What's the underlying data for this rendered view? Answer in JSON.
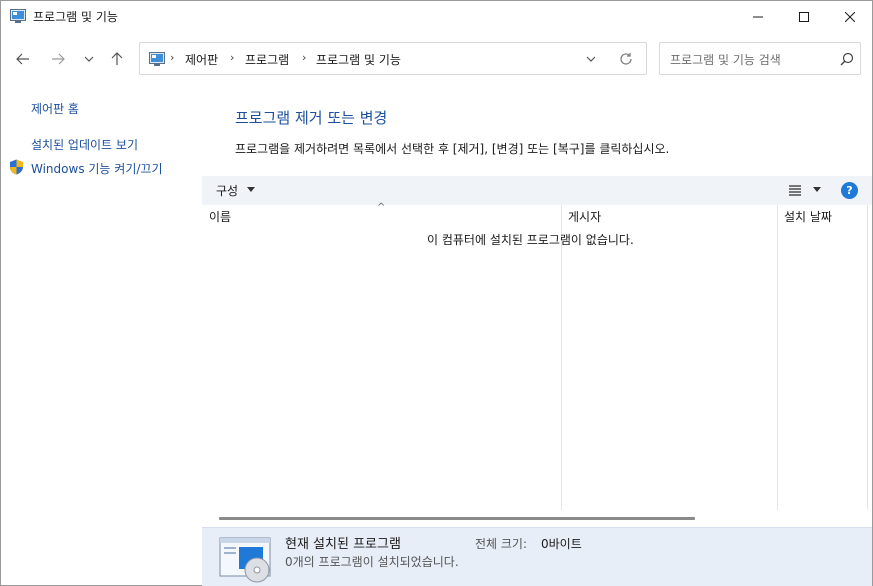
{
  "window": {
    "title": "프로그램 및 기능",
    "icon": "control-panel-icon",
    "controls": [
      "minimize-icon",
      "maximize-icon",
      "close-icon"
    ]
  },
  "address_bar": {
    "breadcrumbs": [
      "제어판",
      "프로그램",
      "프로그램 및 기능"
    ],
    "nav_icons": [
      "back-arrow-icon",
      "forward-arrow-icon",
      "recent-dropdown-icon",
      "up-arrow-icon",
      "refresh-icon"
    ]
  },
  "search": {
    "placeholder": "프로그램 및 기능 검색"
  },
  "sidebar": {
    "items": [
      {
        "label": "제어판 홈"
      },
      {
        "label": "설치된 업데이트 보기"
      },
      {
        "label": "Windows 기능 켜기/끄기",
        "icon": "uac-shield-icon"
      }
    ]
  },
  "main": {
    "heading": "프로그램 제거 또는 변경",
    "description": "프로그램을 제거하려면 목록에서 선택한 후 [제거], [변경] 또는 [복구]를 클릭하십시오.",
    "toolbar": {
      "organize_label": "구성",
      "help_label": "?"
    },
    "columns": [
      "이름",
      "게시자",
      "설치 날짜"
    ],
    "empty_message": "이 컴퓨터에 설치된 프로그램이 없습니다."
  },
  "details": {
    "title": "현재 설치된 프로그램",
    "subtitle": "0개의 프로그램이 설치되었습니다.",
    "size_label": "전체 크기:",
    "size_value": "0바이트"
  },
  "colors": {
    "link": "#1c4e9e",
    "toolbar_bg": "#f0f3f8",
    "details_bg": "#e8eef8",
    "help_blue": "#1e7ad6"
  }
}
